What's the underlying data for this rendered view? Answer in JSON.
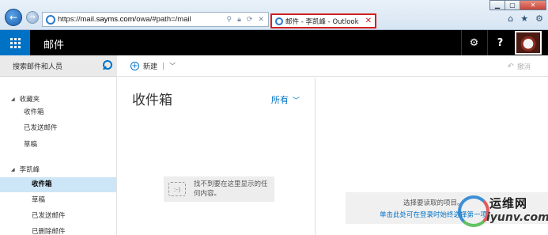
{
  "browser": {
    "url_prefix": "https://mail.",
    "url_domain": "sayms.com",
    "url_path": "/owa/#path=/mail",
    "tab_title": "邮件 - 李凯峰 - Outlook",
    "address_icons": [
      "search-icon",
      "lock-icon",
      "refresh-icon",
      "close-icon"
    ]
  },
  "appbar": {
    "title": "邮件",
    "settings_icon": "⚙",
    "help_label": "?"
  },
  "search": {
    "placeholder": "搜索邮件和人员"
  },
  "nav": {
    "favorites": {
      "label": "收藏夹",
      "items": [
        "收件箱",
        "已发送邮件",
        "草稿"
      ]
    },
    "account": {
      "label": "李凯峰",
      "items": [
        "收件箱",
        "草稿",
        "已发送邮件",
        "已删除邮件"
      ],
      "selected_index": 0
    }
  },
  "commands": {
    "new_label": "新建",
    "undo_label": "撤消"
  },
  "list": {
    "title": "收件箱",
    "filter_label": "所有",
    "empty_text": "找不到要在这里显示的任何内容。",
    "empty_icon": ":-)"
  },
  "reading": {
    "hint": "选择要读取的项目。",
    "link": "单击此处可在登录时始终选择第一项"
  },
  "watermark": {
    "cn": "运维网",
    "en": "iyunv.com"
  }
}
